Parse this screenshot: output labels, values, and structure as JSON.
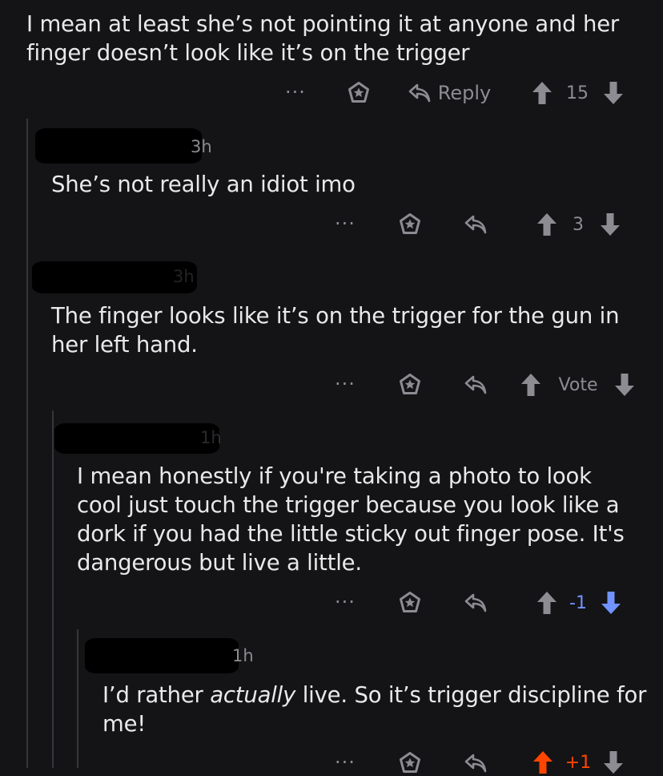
{
  "comments": [
    {
      "body": "I mean at least she’s not pointing it at anyone and her finger doesn’t look like it’s on the trigger",
      "more": "···",
      "reply_label": "Reply",
      "score": "15",
      "vote_state": "none"
    },
    {
      "time": "3h",
      "body": "She’s not really an idiot imo",
      "more": "···",
      "score": "3",
      "vote_state": "none"
    },
    {
      "time": "3h",
      "body": "The finger looks like it’s on the trigger for the gun in her left hand.",
      "more": "···",
      "score": "Vote",
      "vote_state": "none"
    },
    {
      "time": "1h",
      "body": "I mean honestly if you're taking a photo to look cool just touch the trigger because you look like a dork if you had the little sticky out finger pose. It's dangerous but live a little.",
      "more": "···",
      "score": "-1",
      "vote_state": "downvoted"
    },
    {
      "time": "1h",
      "body_before": "I’d rather ",
      "body_emphasis": "actually",
      "body_after": " live. So it’s trigger discipline for me!",
      "more": "···",
      "score": "+1",
      "vote_state": "upvoted"
    }
  ],
  "colors": {
    "background": "#141416",
    "muted": "#8c8c92",
    "downvote": "#7193ff",
    "upvote": "#ff4500"
  },
  "icons": [
    "more-icon",
    "award-icon",
    "reply-icon",
    "upvote-icon",
    "downvote-icon"
  ]
}
